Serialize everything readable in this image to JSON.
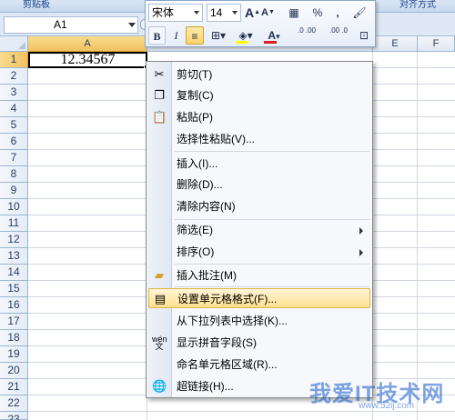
{
  "ribbon": {
    "groups": [
      "剪贴板",
      "对齐方式"
    ]
  },
  "formula_bar": {
    "name_box": "A1"
  },
  "columns": [
    "A",
    "E",
    "F"
  ],
  "rows": [
    "1",
    "2",
    "3",
    "4",
    "5",
    "6",
    "7",
    "8",
    "9",
    "10",
    "11",
    "12",
    "13",
    "14",
    "15",
    "16",
    "17",
    "18",
    "19",
    "20",
    "21",
    "22",
    "23"
  ],
  "cell_A1": "12.34567",
  "mini_toolbar": {
    "font_name": "宋体",
    "font_size": "14",
    "grow_font": "A",
    "shrink_font": "A",
    "percent": "%",
    "comma": ",",
    "bold": "B",
    "italic": "I",
    "font_color_letter": "A",
    "increase_decimal": ".0 .00",
    "decrease_decimal": ".00 .0",
    "accent_colors": {
      "highlight": "#ffff00",
      "font": "#e02020",
      "pressed": "#ffd36a"
    }
  },
  "context_menu": {
    "items": [
      {
        "label": "剪切(T)",
        "icon": "scissors-icon"
      },
      {
        "label": "复制(C)",
        "icon": "copy-icon"
      },
      {
        "label": "粘贴(P)",
        "icon": "paste-icon"
      },
      {
        "label": "选择性粘贴(V)...",
        "icon": ""
      },
      {
        "label": "插入(I)...",
        "icon": ""
      },
      {
        "label": "删除(D)...",
        "icon": ""
      },
      {
        "label": "清除内容(N)",
        "icon": ""
      },
      {
        "label": "筛选(E)",
        "icon": "",
        "submenu": true
      },
      {
        "label": "排序(O)",
        "icon": "",
        "submenu": true
      },
      {
        "label": "插入批注(M)",
        "icon": "comment-icon"
      },
      {
        "label": "设置单元格格式(F)...",
        "icon": "format-cells-icon",
        "highlighted": true
      },
      {
        "label": "从下拉列表中选择(K)...",
        "icon": ""
      },
      {
        "label": "显示拼音字段(S)",
        "icon": "phonetic-icon"
      },
      {
        "label": "命名单元格区域(R)...",
        "icon": ""
      },
      {
        "label": "超链接(H)...",
        "icon": "hyperlink-icon"
      }
    ]
  },
  "watermark": {
    "text": "我爱IT技术网",
    "url": "www.52ij.com"
  }
}
